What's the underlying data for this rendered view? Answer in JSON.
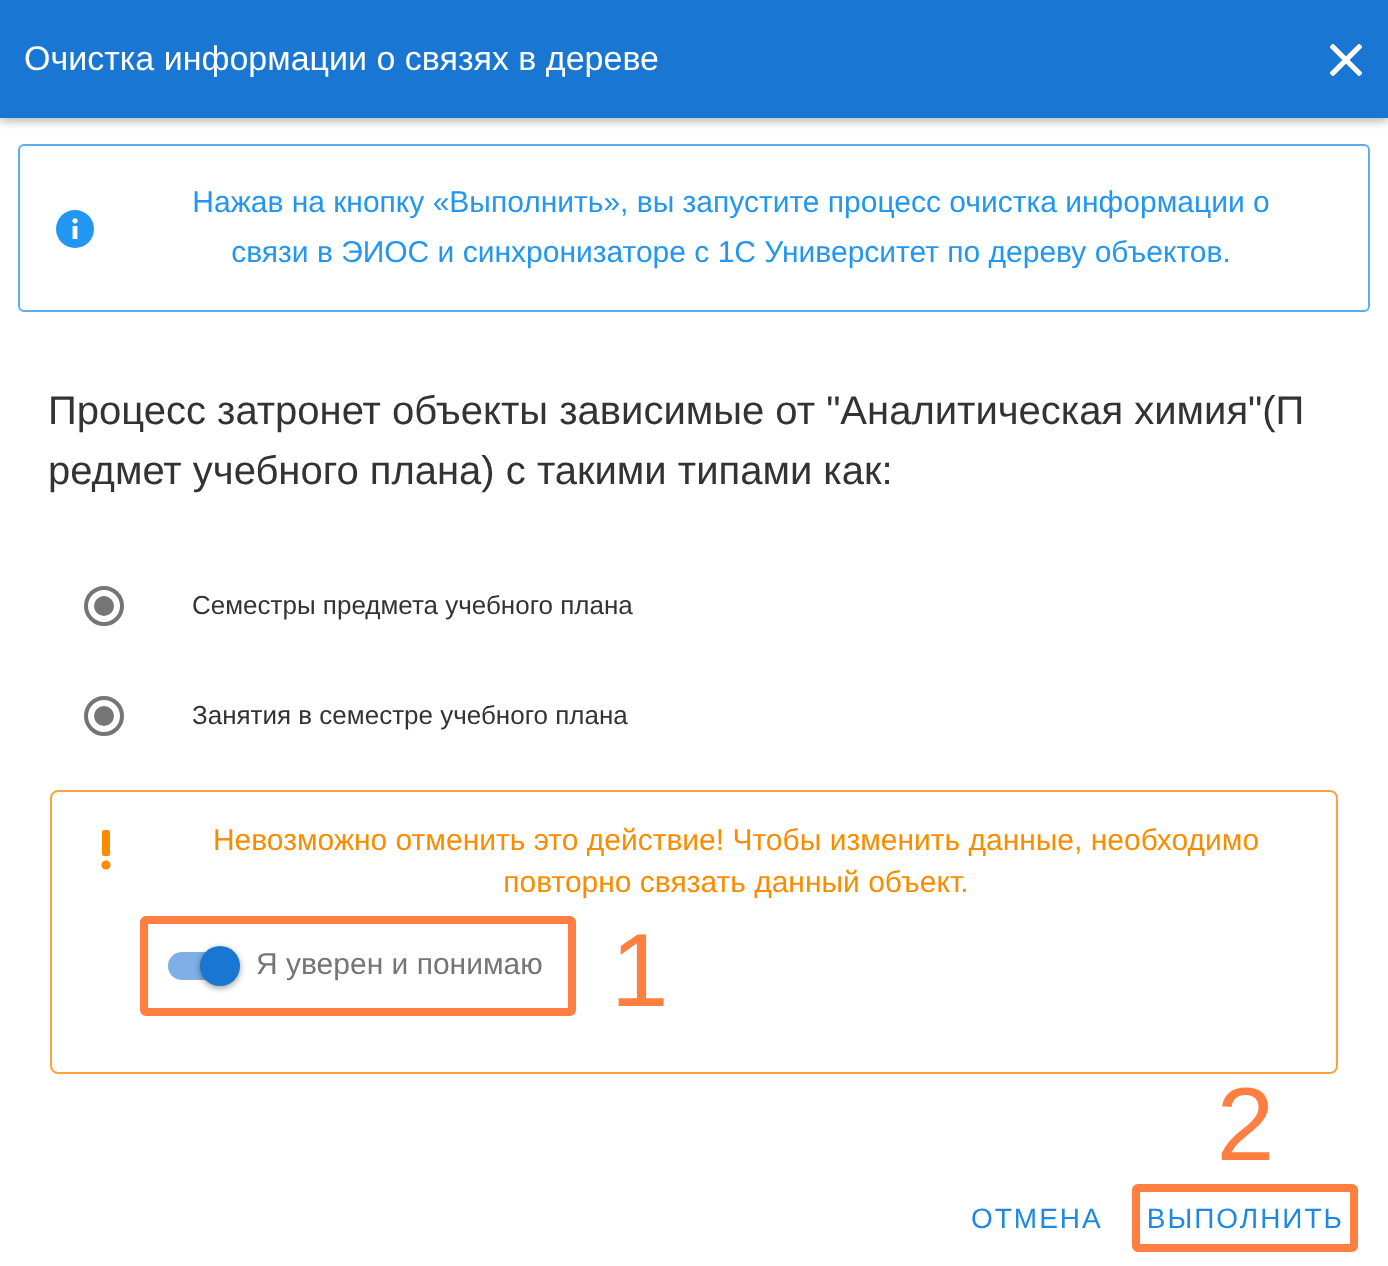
{
  "dialog": {
    "title": "Очистка информации о связях в дереве"
  },
  "info": {
    "text": "Нажав на кнопку «Выполнить», вы запустите процесс очистка информации о связи в ЭИОС и синхронизаторе с 1С Университет по дереву объектов."
  },
  "description": "Процесс затронет объекты зависимые от \"Аналитическая химия\"(Предмет учебного плана) с такими типами как:",
  "object_types": [
    {
      "label": "Семестры предмета учебного плана",
      "checked": true
    },
    {
      "label": "Занятия в семестре учебного плана",
      "checked": true
    }
  ],
  "warning": {
    "text": "Невозможно отменить это действие! Чтобы изменить данные, необходимо повторно связать данный объект.",
    "confirm": {
      "label": "Я уверен и понимаю",
      "on": true,
      "annotation": "1"
    }
  },
  "actions": [
    {
      "label": "ОТМЕНА"
    },
    {
      "label": "ВЫПОЛНИТЬ",
      "annotation": "2"
    }
  ]
}
